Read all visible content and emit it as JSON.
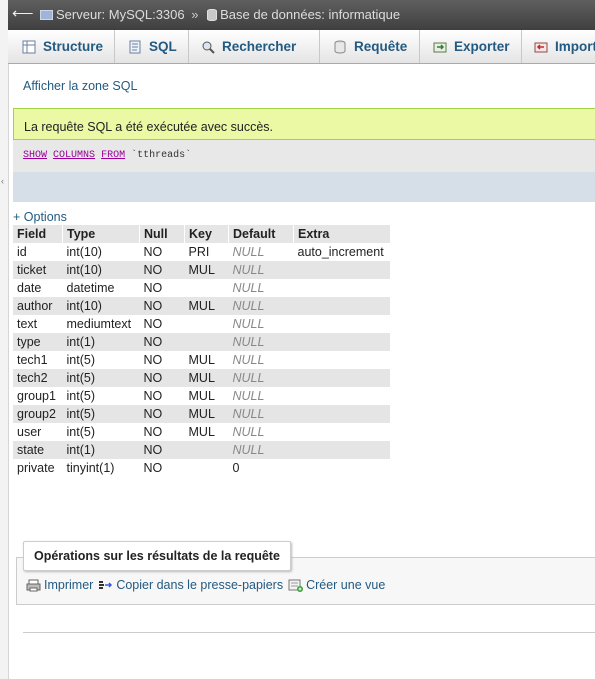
{
  "breadcrumb": {
    "server": "Serveur: MySQL:3306",
    "separator": "»",
    "database": "Base de données: informatique"
  },
  "tabs": [
    {
      "label": "Structure",
      "icon": "structure-icon"
    },
    {
      "label": "SQL",
      "icon": "sql-icon"
    },
    {
      "label": "Rechercher",
      "icon": "search-icon"
    },
    {
      "label": "Requête",
      "icon": "query-icon"
    },
    {
      "label": "Exporter",
      "icon": "export-icon"
    },
    {
      "label": "Import",
      "icon": "import-icon"
    }
  ],
  "sql_toggle": "Afficher la zone SQL",
  "message": {
    "success": "La requête SQL a été exécutée avec succès."
  },
  "query": {
    "kw1": "SHOW",
    "kw2": "COLUMNS",
    "kw3": "FROM",
    "table": "`tthreads`"
  },
  "options_label": "+ Options",
  "table": {
    "headers": [
      "Field",
      "Type",
      "Null",
      "Key",
      "Default",
      "Extra"
    ],
    "rows": [
      [
        "id",
        "int(10)",
        "NO",
        "PRI",
        "NULL",
        "auto_increment"
      ],
      [
        "ticket",
        "int(10)",
        "NO",
        "MUL",
        "NULL",
        ""
      ],
      [
        "date",
        "datetime",
        "NO",
        "",
        "NULL",
        ""
      ],
      [
        "author",
        "int(10)",
        "NO",
        "MUL",
        "NULL",
        ""
      ],
      [
        "text",
        "mediumtext",
        "NO",
        "",
        "NULL",
        ""
      ],
      [
        "type",
        "int(1)",
        "NO",
        "",
        "NULL",
        ""
      ],
      [
        "tech1",
        "int(5)",
        "NO",
        "MUL",
        "NULL",
        ""
      ],
      [
        "tech2",
        "int(5)",
        "NO",
        "MUL",
        "NULL",
        ""
      ],
      [
        "group1",
        "int(5)",
        "NO",
        "MUL",
        "NULL",
        ""
      ],
      [
        "group2",
        "int(5)",
        "NO",
        "MUL",
        "NULL",
        ""
      ],
      [
        "user",
        "int(5)",
        "NO",
        "MUL",
        "NULL",
        ""
      ],
      [
        "state",
        "int(1)",
        "NO",
        "",
        "NULL",
        ""
      ],
      [
        "private",
        "tinyint(1)",
        "NO",
        "",
        "0",
        ""
      ]
    ]
  },
  "operations": {
    "legend": "Opérations sur les résultats de la requête",
    "links": [
      {
        "label": "Imprimer",
        "icon": "print-icon"
      },
      {
        "label": "Copier dans le presse-papiers",
        "icon": "clipboard-icon"
      },
      {
        "label": "Créer une vue",
        "icon": "create-view-icon"
      }
    ]
  },
  "colors": {
    "link": "#235a81",
    "success_bg": "#ebf8a4",
    "keyword": "#990099"
  }
}
